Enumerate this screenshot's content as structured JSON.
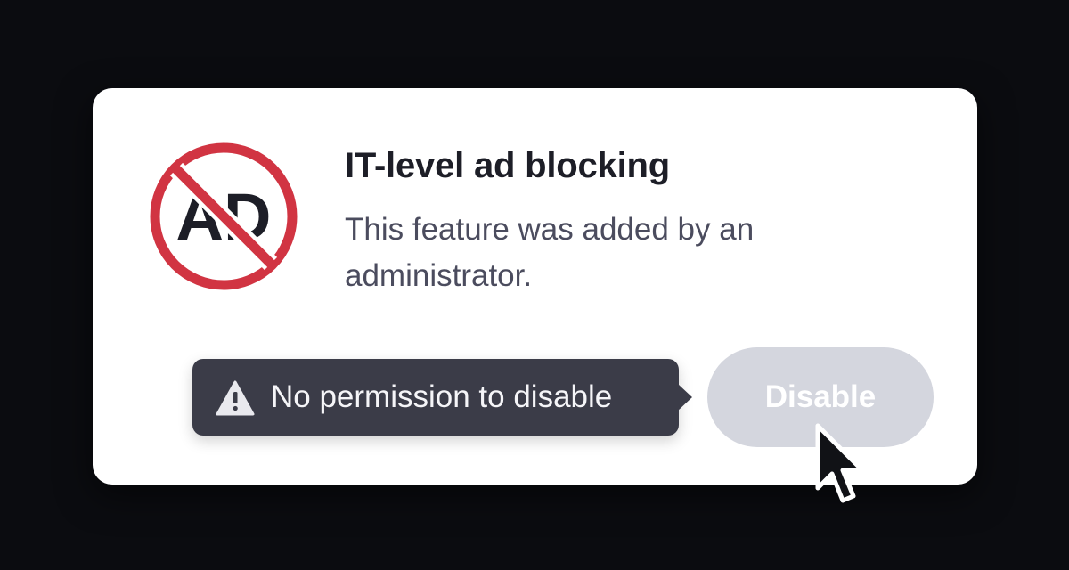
{
  "dialog": {
    "title": "IT-level ad blocking",
    "description": "This feature was added by an administrator.",
    "icon": "no-ads-icon",
    "icon_text": "AD"
  },
  "tooltip": {
    "icon": "warning-icon",
    "text": "No permission to disable"
  },
  "actions": {
    "disable_label": "Disable",
    "disable_state": "disabled"
  },
  "pointer": {
    "icon": "mouse-pointer-icon"
  },
  "colors": {
    "background": "#0b0c10",
    "card": "#ffffff",
    "prohibition_red": "#d13442",
    "tooltip_bg": "#3b3c48",
    "button_disabled_bg": "#d4d6de",
    "title_text": "#1d1e27",
    "body_text": "#4b4c5e"
  }
}
